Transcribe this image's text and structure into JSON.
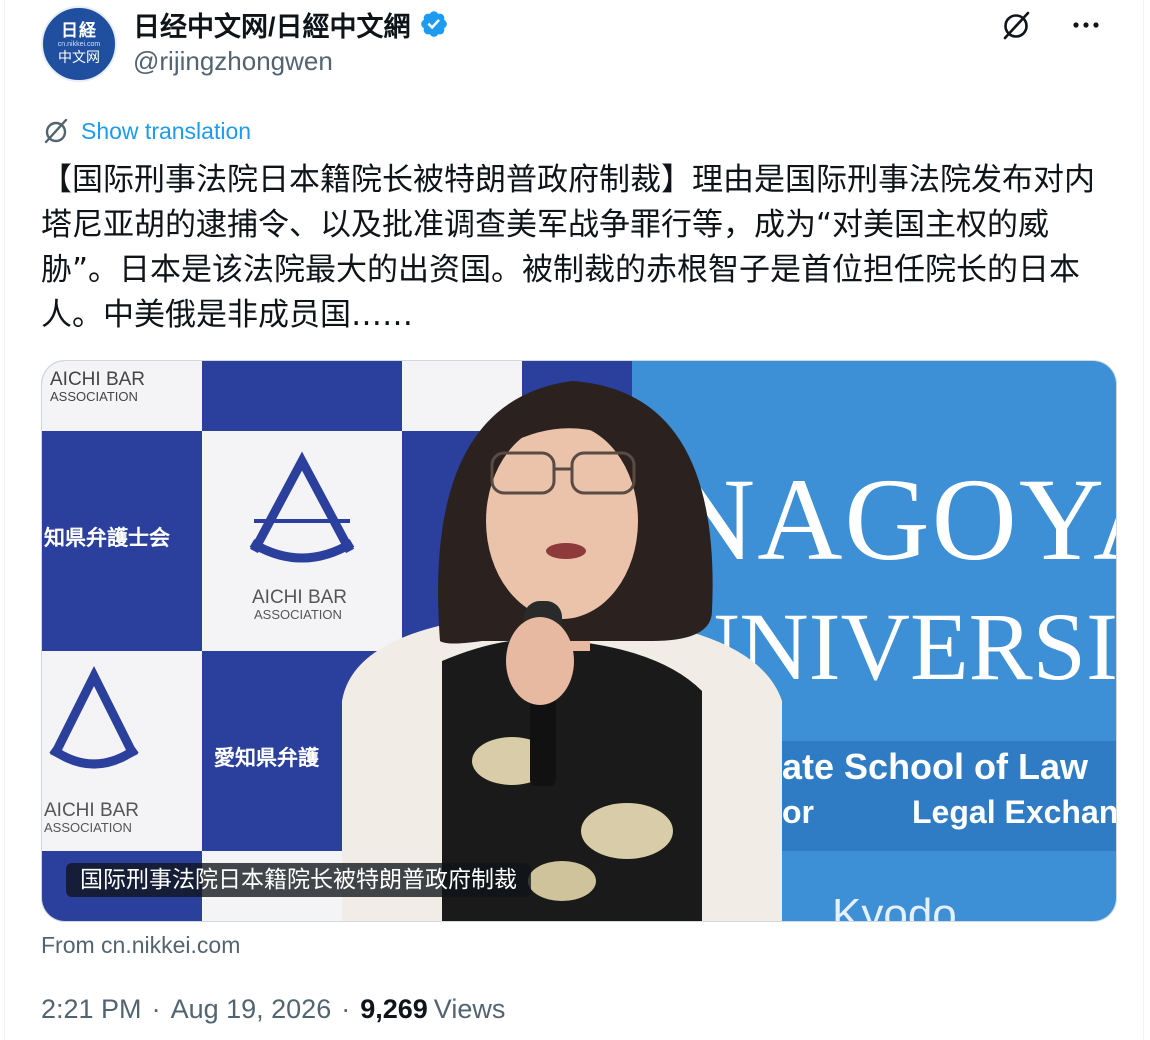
{
  "account": {
    "display_name": "日经中文网/日經中文網",
    "handle": "@rijingzhongwen",
    "avatar": {
      "line1": "日経",
      "line2": "cn.nikkei.com",
      "line3": "中文网"
    },
    "verified_icon": "verified-badge-icon"
  },
  "actions": {
    "grok_icon": "grok-icon",
    "more_icon": "more-icon"
  },
  "translation": {
    "label": "Show translation",
    "icon": "grok-icon"
  },
  "tweet": {
    "text": "【国际刑事法院日本籍院长被特朗普政府制裁】理由是国际刑事法院发布对内塔尼亚胡的逮捕令、以及批准调查美军战争罪行等，成为“对美国主权的威胁”。日本是该法院最大的出资国。被制裁的赤根智子是首位担任院长的日本人。中美俄是非成员国……"
  },
  "media": {
    "caption": "国际刑事法院日本籍院长被特朗普政府制裁",
    "backdrop_text": {
      "assoc_en_1": "AICHI BAR",
      "assoc_en_2": "ASSOCIATION",
      "assoc_jp": "知県弁護士会",
      "assoc_jp2": "愛知県弁護",
      "uni_1": "NAGOYA",
      "uni_2": "UNIVERSIT",
      "uni_3": "ate School of Law",
      "uni_4": "Legal Exchan",
      "uni_4_prefix": "or",
      "uni_5": "Kyodo"
    },
    "colors": {
      "blue": "#2b3f9c",
      "sky": "#3d8fd6"
    }
  },
  "source": {
    "label": "From cn.nikkei.com"
  },
  "meta": {
    "time": "2:21 PM",
    "date": "Aug 19, 2026",
    "views_count": "9,269",
    "views_label": "Views",
    "separator": "·"
  },
  "colors": {
    "accent": "#1d9bf0",
    "muted": "#536471",
    "text": "#0f1419"
  }
}
